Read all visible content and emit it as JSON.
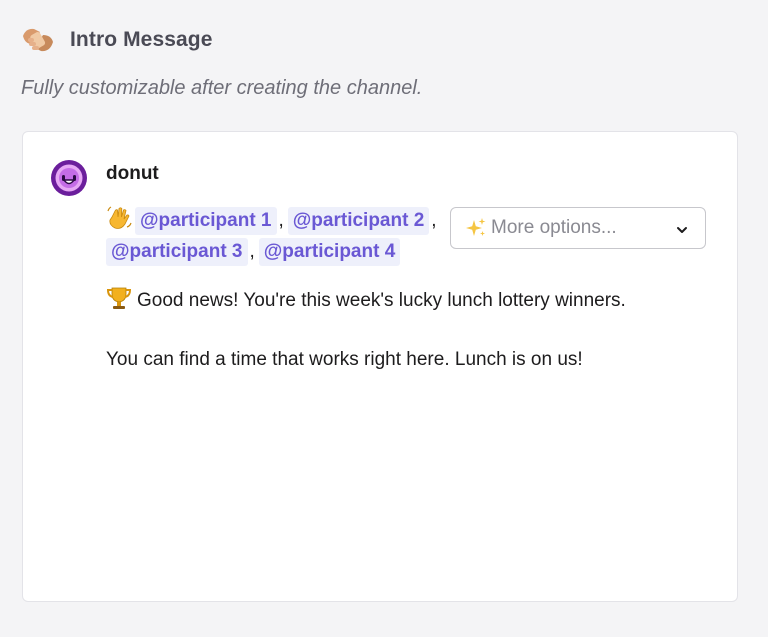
{
  "header": {
    "icon": "handshake-icon",
    "title": "Intro Message",
    "subtitle": "Fully customizable after creating the channel."
  },
  "message": {
    "avatar_icon": "donut-bot-avatar",
    "sender": "donut",
    "wave_icon": "waving-hand-icon",
    "mentions": [
      "@participant 1",
      "@participant 2",
      "@participant 3",
      "@participant 4"
    ],
    "separator": ",",
    "dropdown": {
      "icon": "sparkles-icon",
      "placeholder": "More options...",
      "chevron_icon": "chevron-down-icon"
    },
    "trophy_icon": "trophy-icon",
    "line1": "Good news! You're this week's lucky lunch lottery winners.",
    "line2": "You can find a time that works right here. Lunch is on us!"
  },
  "colors": {
    "mention_text": "#6a58d4",
    "mention_bg": "#eef0fb",
    "avatar": "#6b1e9c",
    "background": "#f4f4f6"
  }
}
